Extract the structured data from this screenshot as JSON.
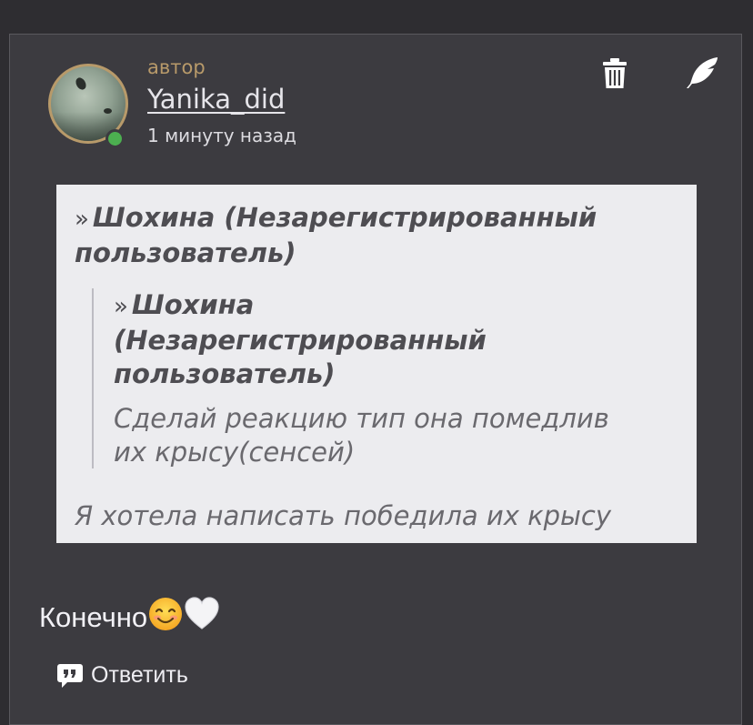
{
  "post": {
    "role_label": "автор",
    "username": "Yanika_did",
    "timestamp": "1 минуту назад",
    "online": true,
    "colors": {
      "accent": "#b89a6a",
      "online": "#4caf50",
      "card_bg": "#3c3b40",
      "quote_bg": "#ececef"
    },
    "icons": {
      "delete": "trash-icon",
      "edit": "feather-icon",
      "reply": "quote-bubble-icon"
    }
  },
  "quote": {
    "marker": "»",
    "author": "Шохина (Незарегистрированный пользователь)",
    "nested": {
      "marker": "»",
      "author_line1": "Шохина",
      "author_line2": "(Незарегистрированный",
      "author_line3": "пользователь)",
      "text_line1": "Сделай реакцию тип она помедлив",
      "text_line2": "их крысу(сенсей)"
    },
    "text": "Я хотела написать победила их крысу"
  },
  "message": {
    "text": "Конечно"
  },
  "actions": {
    "reply_label": "Ответить"
  }
}
